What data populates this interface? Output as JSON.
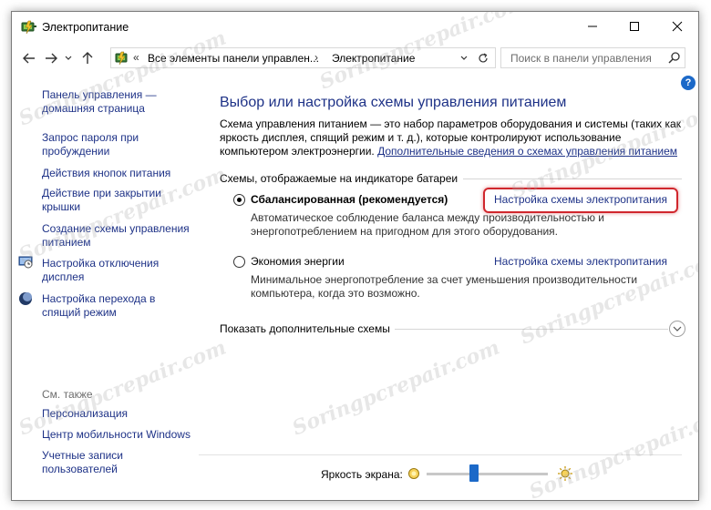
{
  "window": {
    "title": "Электропитание",
    "controls": {
      "minimize": "—",
      "maximize": "☐",
      "close": "✕"
    }
  },
  "nav": {
    "address_chevron": "«",
    "address_segments": [
      "Все элементы панели управлен...",
      "Электропитание"
    ],
    "address_separator": "›",
    "search_placeholder": "Поиск в панели управления"
  },
  "sidebar": {
    "items": [
      {
        "label": "Панель управления — домашняя страница"
      },
      {
        "label": "Запрос пароля при пробуждении"
      },
      {
        "label": "Действия кнопок питания"
      },
      {
        "label": "Действие при закрытии крышки"
      },
      {
        "label": "Создание схемы управления питанием"
      },
      {
        "label": "Настройка отключения дисплея",
        "icon": "display-icon"
      },
      {
        "label": "Настройка перехода в спящий режим",
        "icon": "moon-icon"
      }
    ],
    "see_also_title": "См. также",
    "see_also": [
      {
        "label": "Персонализация"
      },
      {
        "label": "Центр мобильности Windows"
      },
      {
        "label": "Учетные записи пользователей"
      }
    ]
  },
  "main": {
    "help": "?",
    "title": "Выбор или настройка схемы управления питанием",
    "intro_text": "Схема управления питанием — это набор параметров оборудования и системы (таких как яркость дисплея, спящий режим и т. д.), которые контролируют использование компьютером электроэнергии.",
    "intro_link": "Дополнительные сведения о схемах управления питанием",
    "section_label": "Схемы, отображаемые на индикаторе батареи",
    "plans": [
      {
        "name": "Сбалансированная (рекомендуется)",
        "selected": true,
        "description": "Автоматическое соблюдение баланса между производительностью и энергопотреблением на пригодном для этого оборудования.",
        "link": "Настройка схемы электропитания"
      },
      {
        "name": "Экономия энергии",
        "selected": false,
        "description": "Минимальное энергопотребление за счет уменьшения производительности компьютера, когда это возможно.",
        "link": "Настройка схемы электропитания"
      }
    ],
    "more_plans": "Показать дополнительные схемы",
    "highlight_color": "#d0272d"
  },
  "brightness": {
    "label": "Яркость экрана:",
    "level_percent": 38
  },
  "watermark": "Soringpcrepair.com",
  "colors": {
    "link": "#1e3287",
    "accent": "#1c69c8"
  }
}
